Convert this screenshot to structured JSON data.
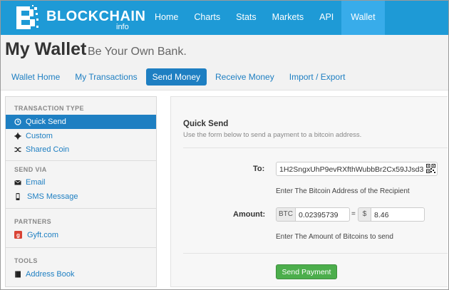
{
  "brand": {
    "name": "BLOCKCHAIN",
    "sub": "info"
  },
  "nav": [
    "Home",
    "Charts",
    "Stats",
    "Markets",
    "API",
    "Wallet"
  ],
  "header": {
    "title": "My Wallet",
    "subtitle": "Be Your Own Bank."
  },
  "tabs": [
    "Wallet Home",
    "My Transactions",
    "Send Money",
    "Receive Money",
    "Import / Export"
  ],
  "sidebar": {
    "transaction_type": {
      "heading": "TRANSACTION TYPE",
      "items": [
        "Quick Send",
        "Custom",
        "Shared Coin"
      ]
    },
    "send_via": {
      "heading": "SEND VIA",
      "items": [
        "Email",
        "SMS Message"
      ]
    },
    "partners": {
      "heading": "PARTNERS",
      "items": [
        "Gyft.com"
      ]
    },
    "tools": {
      "heading": "TOOLS",
      "items": [
        "Address Book"
      ]
    }
  },
  "form": {
    "title": "Quick Send",
    "description": "Use the form below to send a payment to a bitcoin address.",
    "to_label": "To:",
    "to_value": "1H2SngxUhP9evRXfthWubbBr2Cx59JJsd3",
    "to_help": "Enter The Bitcoin Address of the Recipient",
    "amount_label": "Amount:",
    "btc_addon": "BTC",
    "btc_value": "0.02395739",
    "eq": "=",
    "usd_addon": "$",
    "usd_value": "8.46",
    "amount_help": "Enter The Amount of Bitcoins to send",
    "send_button": "Send Payment"
  },
  "colors": {
    "topbar": "#1e9ad6",
    "accent": "#1e7fc2",
    "send": "#4cae4c"
  }
}
